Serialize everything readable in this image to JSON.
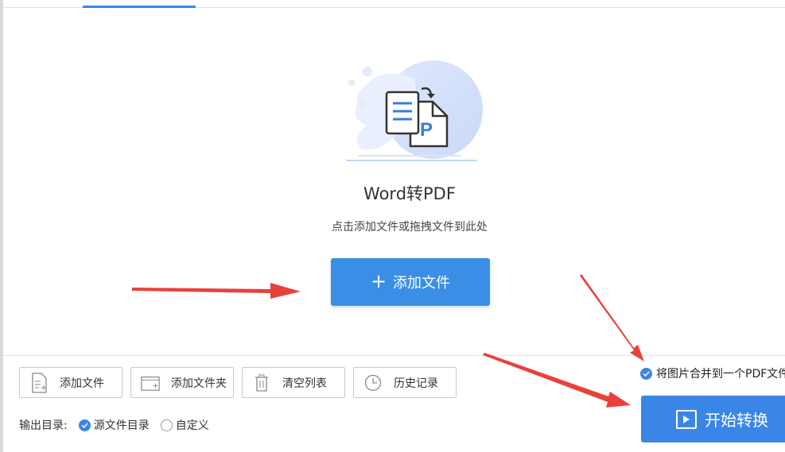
{
  "drop_area": {
    "title": "Word转PDF",
    "hint": "点击添加文件或拖拽文件到此处",
    "add_button_label": "添加文件"
  },
  "toolbar": {
    "add_file": "添加文件",
    "add_folder": "添加文件夹",
    "clear_list": "清空列表",
    "history": "历史记录"
  },
  "output": {
    "label": "输出目录:",
    "source_dir": "源文件目录",
    "custom": "自定义",
    "selected": "源文件目录"
  },
  "merge_option": {
    "label": "将图片合并到一个PDF文件",
    "checked": true
  },
  "start_button": {
    "label": "开始转换"
  },
  "colors": {
    "accent": "#3a86e6",
    "annotation_arrow": "#e8413b"
  }
}
